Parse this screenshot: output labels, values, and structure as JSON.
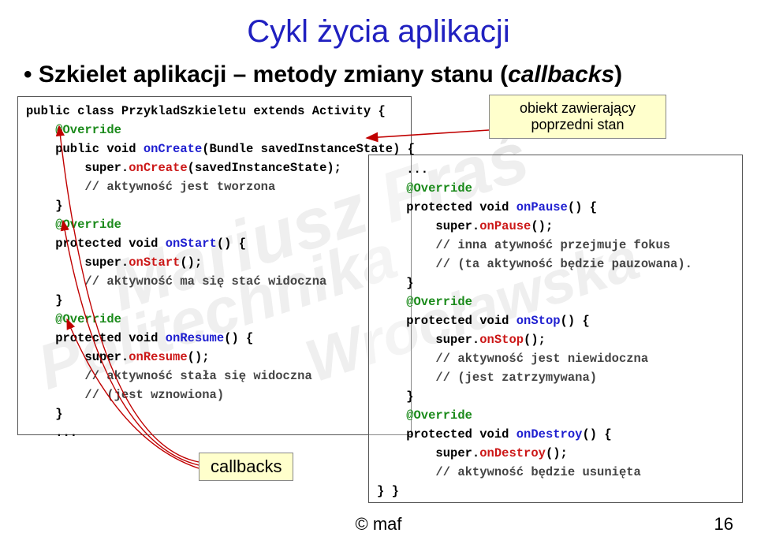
{
  "title": "Cykl życia aplikacji",
  "subtitle_plain": "Szkielet aplikacji – metody zmiany stanu (",
  "subtitle_ital": "callbacks",
  "subtitle_close": ")",
  "tag_obj_l1": "obiekt zawierający",
  "tag_obj_l2": "poprzedni stan",
  "tag_callbacks": "callbacks",
  "footer_copy": "© maf",
  "footer_page": "16",
  "watermarks": {
    "wm1": "Mariusz Fraś",
    "wm2": "Politechnika",
    "wm3": "Wrocławska"
  },
  "code_left": {
    "l1a": "public class PrzykladSzkieletu extends Activity {",
    "l2": "    @Override",
    "l3a": "    public void ",
    "l3b": "onCreate",
    "l3c": "(Bundle savedInstanceState) {",
    "l4a": "        super.",
    "l4b": "onCreate",
    "l4c": "(savedInstanceState);",
    "l5": "        // aktywność jest tworzona",
    "l6": "    }",
    "l7": "    @Override",
    "l8a": "    protected void ",
    "l8b": "onStart",
    "l8c": "() {",
    "l9a": "        super.",
    "l9b": "onStart",
    "l9c": "();",
    "l10": "        // aktywność ma się stać widoczna",
    "l11": "    }",
    "l12": "    @Override",
    "l13a": "    protected void ",
    "l13b": "onResume",
    "l13c": "() {",
    "l14a": "        super.",
    "l14b": "onResume",
    "l14c": "();",
    "l15": "        // aktywność stała się widoczna",
    "l16": "        // (jest wznowiona)",
    "l17": "    }",
    "l18": "    ..."
  },
  "code_right": {
    "l1": "    ...",
    "l2": "    @Override",
    "l3a": "    protected void ",
    "l3b": "onPause",
    "l3c": "() {",
    "l4a": "        super.",
    "l4b": "onPause",
    "l4c": "();",
    "l5": "        // inna atywność przejmuje fokus",
    "l6": "        // (ta aktywność będzie pauzowana).",
    "l7": "    }",
    "l8": "    @Override",
    "l9a": "    protected void ",
    "l9b": "onStop",
    "l9c": "() {",
    "l10a": "        super.",
    "l10b": "onStop",
    "l10c": "();",
    "l11": "        // aktywność jest niewidoczna",
    "l12": "        // (jest zatrzymywana)",
    "l13": "    }",
    "l14": "    @Override",
    "l15a": "    protected void ",
    "l15b": "onDestroy",
    "l15c": "() {",
    "l16a": "        super.",
    "l16b": "onDestroy",
    "l16c": "();",
    "l17": "        // aktywność będzie usunięta",
    "l18": "} }"
  }
}
